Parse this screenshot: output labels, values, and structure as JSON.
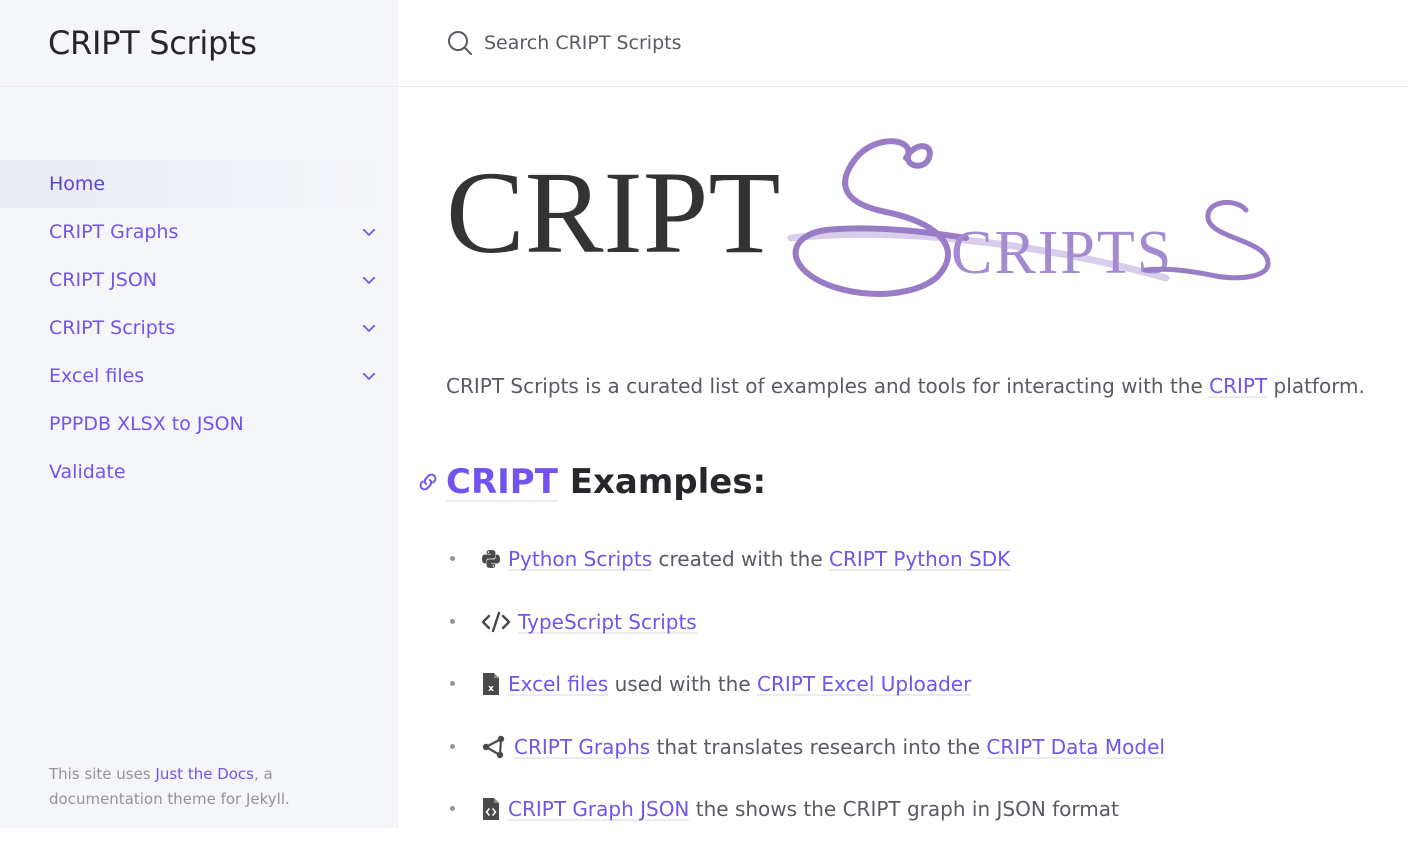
{
  "sidebar": {
    "site_title": "CRIPT Scripts",
    "nav": [
      {
        "label": "Home",
        "active": true,
        "expandable": false
      },
      {
        "label": "CRIPT Graphs",
        "active": false,
        "expandable": true
      },
      {
        "label": "CRIPT JSON",
        "active": false,
        "expandable": true
      },
      {
        "label": "CRIPT Scripts",
        "active": false,
        "expandable": true
      },
      {
        "label": "Excel files",
        "active": false,
        "expandable": true
      },
      {
        "label": "PPPDB XLSX to JSON",
        "active": false,
        "expandable": false
      },
      {
        "label": "Validate",
        "active": false,
        "expandable": false
      }
    ],
    "footer": {
      "prefix": "This site uses ",
      "link": "Just the Docs",
      "suffix": ", a documentation theme for Jekyll."
    }
  },
  "search": {
    "placeholder": "Search CRIPT Scripts"
  },
  "logo": {
    "word1": "CRIPT",
    "word2_initial": "S",
    "word2_rest": "CRIPTS"
  },
  "intro": {
    "before": "CRIPT Scripts is a curated list of examples and tools for interacting with the ",
    "link": "CRIPT",
    "after": " platform."
  },
  "heading": {
    "link": "CRIPT",
    "text": " Examples:"
  },
  "examples": [
    {
      "icon": "python-icon",
      "link1": "Python Scripts",
      "mid": " created with the ",
      "link2": "CRIPT Python SDK",
      "tail": ""
    },
    {
      "icon": "code-icon",
      "link1": "TypeScript Scripts",
      "mid": "",
      "link2": "",
      "tail": ""
    },
    {
      "icon": "excel-file-icon",
      "link1": "Excel files",
      "mid": " used with the ",
      "link2": "CRIPT Excel Uploader",
      "tail": ""
    },
    {
      "icon": "graph-nodes-icon",
      "link1": "CRIPT Graphs",
      "mid": " that translates research into the ",
      "link2": "CRIPT Data Model",
      "tail": ""
    },
    {
      "icon": "code-file-icon",
      "link1": "CRIPT Graph JSON",
      "mid": " the shows the CRIPT graph in JSON format",
      "link2": "",
      "tail": ""
    }
  ],
  "colors": {
    "link": "#7253ed",
    "logo_purple": "#9a7cc6",
    "sidebar_bg": "#f5f6fa"
  }
}
